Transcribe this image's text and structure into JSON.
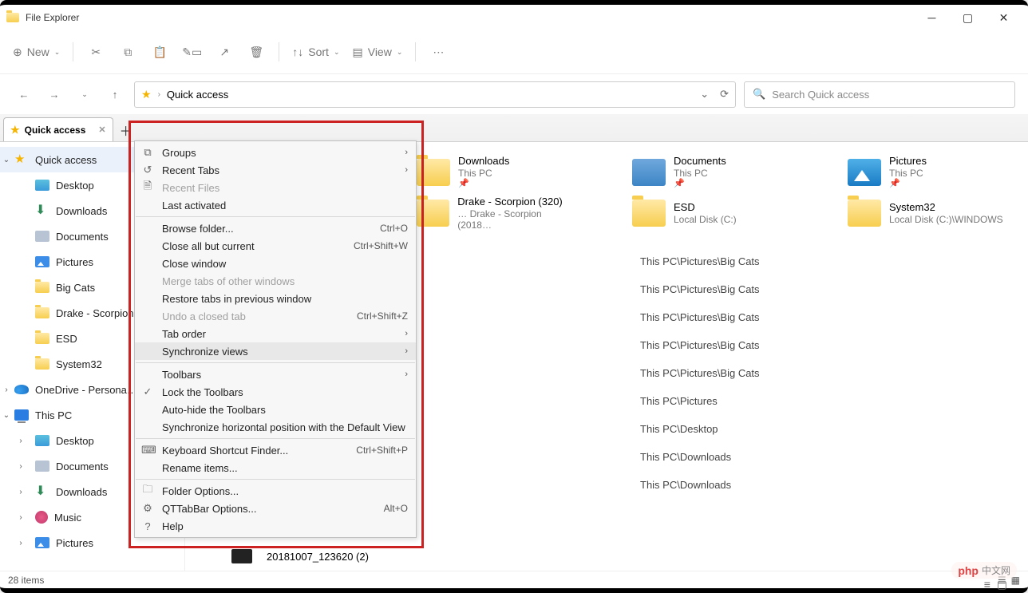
{
  "window": {
    "title": "File Explorer"
  },
  "toolbar": {
    "new_label": "New",
    "sort_label": "Sort",
    "view_label": "View"
  },
  "addressbar": {
    "location": "Quick access"
  },
  "searchbox": {
    "placeholder": "Search Quick access"
  },
  "tabs": [
    {
      "label": "Quick access"
    }
  ],
  "sidebar": {
    "items": [
      {
        "label": "Quick access",
        "icon": "star",
        "chev": "⌄",
        "selected": true,
        "indent": 0
      },
      {
        "label": "Desktop",
        "icon": "desktop",
        "indent": 1
      },
      {
        "label": "Downloads",
        "icon": "downarrow",
        "indent": 1
      },
      {
        "label": "Documents",
        "icon": "doc",
        "indent": 1
      },
      {
        "label": "Pictures",
        "icon": "pic",
        "indent": 1
      },
      {
        "label": "Big Cats",
        "icon": "folder",
        "indent": 1
      },
      {
        "label": "Drake - Scorpion (…",
        "icon": "folder",
        "indent": 1
      },
      {
        "label": "ESD",
        "icon": "folder",
        "indent": 1
      },
      {
        "label": "System32",
        "icon": "folder",
        "indent": 1
      },
      {
        "label": "OneDrive - Persona…",
        "icon": "onedrive",
        "chev": "›",
        "indent": 0
      },
      {
        "label": "This PC",
        "icon": "pc",
        "chev": "⌄",
        "indent": 0
      },
      {
        "label": "Desktop",
        "icon": "desktop",
        "chev": "›",
        "indent": 1
      },
      {
        "label": "Documents",
        "icon": "doc",
        "chev": "›",
        "indent": 1
      },
      {
        "label": "Downloads",
        "icon": "downarrow",
        "chev": "›",
        "indent": 1
      },
      {
        "label": "Music",
        "icon": "music",
        "chev": "›",
        "indent": 1
      },
      {
        "label": "Pictures",
        "icon": "pic",
        "chev": "›",
        "indent": 1
      }
    ]
  },
  "big_icons_row1": [
    {
      "name": "Downloads",
      "sub": "This PC",
      "icon": "folder",
      "pin": true
    },
    {
      "name": "Documents",
      "sub": "This PC",
      "icon": "doc",
      "pin": true
    },
    {
      "name": "Pictures",
      "sub": "This PC",
      "icon": "pic",
      "pin": true
    }
  ],
  "big_icons_row2": [
    {
      "name": "Drake - Scorpion (320)",
      "sub": "… Drake - Scorpion (2018…",
      "icon": "folder"
    },
    {
      "name": "ESD",
      "sub": "Local Disk (C:)",
      "icon": "folder"
    },
    {
      "name": "System32",
      "sub": "Local Disk (C:)\\WINDOWS",
      "icon": "folder"
    }
  ],
  "recent_paths": [
    "This PC\\Pictures\\Big Cats",
    "This PC\\Pictures\\Big Cats",
    "This PC\\Pictures\\Big Cats",
    "This PC\\Pictures\\Big Cats",
    "This PC\\Pictures\\Big Cats",
    "This PC\\Pictures",
    "This PC\\Desktop",
    "This PC\\Downloads",
    "This PC\\Downloads"
  ],
  "recent_last_item": "20181007_123620 (2)",
  "statusbar": {
    "count": "28 items"
  },
  "context_menu": {
    "s1": [
      {
        "label": "Groups",
        "icon": "⧉",
        "sub": true
      },
      {
        "label": "Recent Tabs",
        "icon": "↺",
        "sub": true
      },
      {
        "label": "Recent Files",
        "icon": "🗎",
        "disabled": true
      },
      {
        "label": "Last activated"
      }
    ],
    "s2": [
      {
        "label": "Browse folder...",
        "shortcut": "Ctrl+O"
      },
      {
        "label": "Close all but current",
        "shortcut": "Ctrl+Shift+W"
      },
      {
        "label": "Close window"
      },
      {
        "label": "Merge tabs of other windows",
        "disabled": true
      },
      {
        "label": "Restore tabs in previous window"
      },
      {
        "label": "Undo a closed tab",
        "shortcut": "Ctrl+Shift+Z",
        "disabled": true
      },
      {
        "label": "Tab order",
        "sub": true
      },
      {
        "label": "Synchronize views",
        "sub": true,
        "hover": true
      }
    ],
    "s3": [
      {
        "label": "Toolbars",
        "sub": true
      },
      {
        "label": "Lock the Toolbars",
        "icon": "✓"
      },
      {
        "label": "Auto-hide the Toolbars"
      },
      {
        "label": "Synchronize horizontal position with the Default View"
      }
    ],
    "s4": [
      {
        "label": "Keyboard Shortcut Finder...",
        "icon": "⌨",
        "shortcut": "Ctrl+Shift+P"
      },
      {
        "label": "Rename items..."
      }
    ],
    "s5": [
      {
        "label": "Folder Options...",
        "icon": "🗀"
      },
      {
        "label": "QTTabBar Options...",
        "icon": "⚙",
        "shortcut": "Alt+O"
      },
      {
        "label": "Help",
        "icon": "?"
      }
    ]
  },
  "watermark": {
    "brand": "php",
    "text": "中文网"
  }
}
